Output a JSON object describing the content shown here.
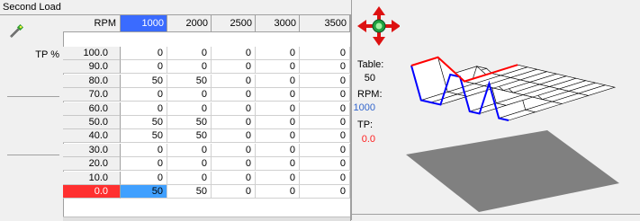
{
  "title": "Second Load",
  "table": {
    "row_axis_label": "TP %",
    "col_axis_label": "RPM",
    "col_headers": [
      "1000",
      "2000",
      "2500",
      "3000",
      "3500"
    ],
    "row_headers": [
      "100.0",
      "90.0",
      "80.0",
      "70.0",
      "60.0",
      "50.0",
      "40.0",
      "30.0",
      "20.0",
      "10.0",
      "0.0"
    ],
    "cells": [
      [
        "0",
        "0",
        "0",
        "0",
        "0"
      ],
      [
        "0",
        "0",
        "0",
        "0",
        "0"
      ],
      [
        "50",
        "50",
        "0",
        "0",
        "0"
      ],
      [
        "0",
        "0",
        "0",
        "0",
        "0"
      ],
      [
        "0",
        "0",
        "0",
        "0",
        "0"
      ],
      [
        "50",
        "50",
        "0",
        "0",
        "0"
      ],
      [
        "50",
        "50",
        "0",
        "0",
        "0"
      ],
      [
        "0",
        "0",
        "0",
        "0",
        "0"
      ],
      [
        "0",
        "0",
        "0",
        "0",
        "0"
      ],
      [
        "0",
        "0",
        "0",
        "0",
        "0"
      ],
      [
        "50",
        "50",
        "0",
        "0",
        "0"
      ]
    ],
    "selected_col": 0,
    "selected_row": 10
  },
  "readout": {
    "table_label": "Table:",
    "table_value": "50",
    "rpm_label": "RPM:",
    "rpm_value": "1000",
    "tp_label": "TP:",
    "tp_value": "0.0"
  },
  "colors": {
    "selected_header": "#3a6bff",
    "active_row": "#ff3030",
    "active_cell": "#40a0ff",
    "rpm_value": "#3366cc",
    "tp_value": "#ff2020",
    "surface_rpm_line": "#0000ff",
    "surface_tp_line": "#ff0000",
    "shadow": "#808080"
  },
  "icons": {
    "wand": "wand-icon",
    "navigator": "move-arrows-icon"
  }
}
